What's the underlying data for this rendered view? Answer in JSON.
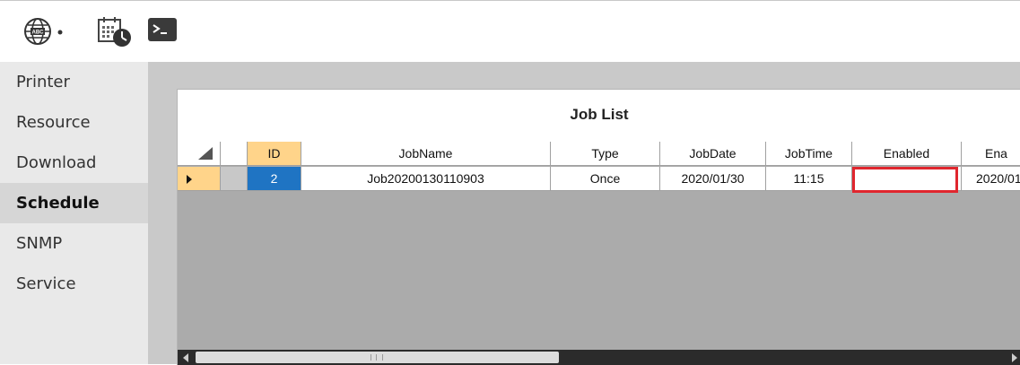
{
  "toolbar": {
    "icons": [
      "globe-abc-icon",
      "dropdown-arrow-icon",
      "calendar-clock-icon",
      "terminal-icon"
    ],
    "globe_text": "ABC"
  },
  "nav": {
    "items": [
      {
        "label": "Printer"
      },
      {
        "label": "Resource"
      },
      {
        "label": "Download"
      },
      {
        "label": "Schedule",
        "active": true
      },
      {
        "label": "SNMP"
      },
      {
        "label": "Service"
      }
    ]
  },
  "panel": {
    "title": "Job List"
  },
  "grid": {
    "columns": [
      "ID",
      "JobName",
      "Type",
      "JobDate",
      "JobTime",
      "Enabled",
      "Ena"
    ],
    "rows": [
      {
        "id": "2",
        "jobname": "Job20200130110903",
        "type": "Once",
        "jobdate": "2020/01/30",
        "jobtime": "11:15",
        "enabled": "",
        "ena": "2020/01"
      }
    ]
  },
  "colors": {
    "selected_header": "#ffd48a",
    "selected_cell": "#1f74c3",
    "highlight_border": "#e0262e",
    "nav_bg": "#e9e9e9",
    "content_bg": "#c9c9c9"
  }
}
